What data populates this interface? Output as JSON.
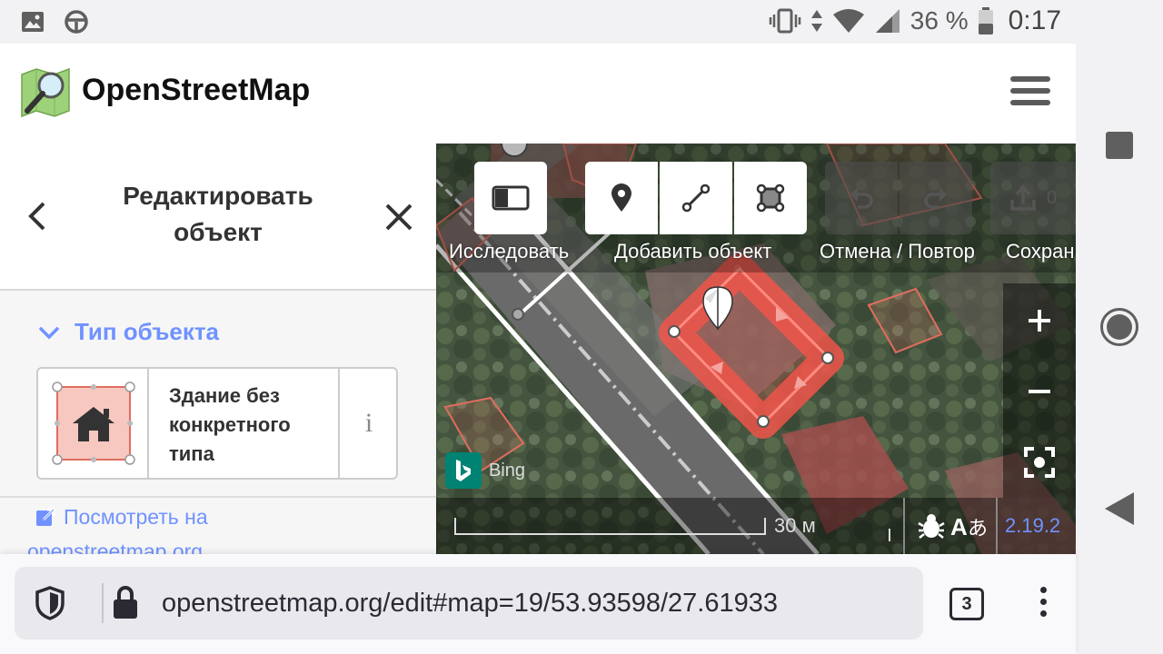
{
  "status_bar": {
    "battery": "36 %",
    "time": "0:17",
    "icons": [
      "image-icon",
      "steering-wheel-icon",
      "vibrate-icon",
      "data-arrows-icon",
      "wifi-icon",
      "signal-icon",
      "battery-icon"
    ]
  },
  "header": {
    "site_title": "OpenStreetMap",
    "menu_icon": "hamburger-icon"
  },
  "sidebar": {
    "title_line1": "Редактировать",
    "title_line2": "объект",
    "section_title": "Тип объекта",
    "preset": {
      "name_line1": "Здание без",
      "name_line2": "конкретного",
      "name_line3": "типа",
      "info_label": "i"
    },
    "view_link_line1": "Посмотреть на",
    "view_link_line2": "openstreetmap.org"
  },
  "map": {
    "toolbar": {
      "browse_label": "Исследовать",
      "add_label": "Добавить объект",
      "undo_redo_label": "Отмена / Повтор",
      "save_label": "Сохрани",
      "save_count": "0"
    },
    "attribution": "Bing",
    "scale": "30 м",
    "version": "2.19.2",
    "colors": {
      "selected_area": "#f0554a",
      "building_outline": "#e06e5f",
      "link": "#7092ff"
    }
  },
  "browser": {
    "url": "openstreetmap.org/edit#map=19/53.93598/27.61933",
    "tab_count": "3"
  }
}
